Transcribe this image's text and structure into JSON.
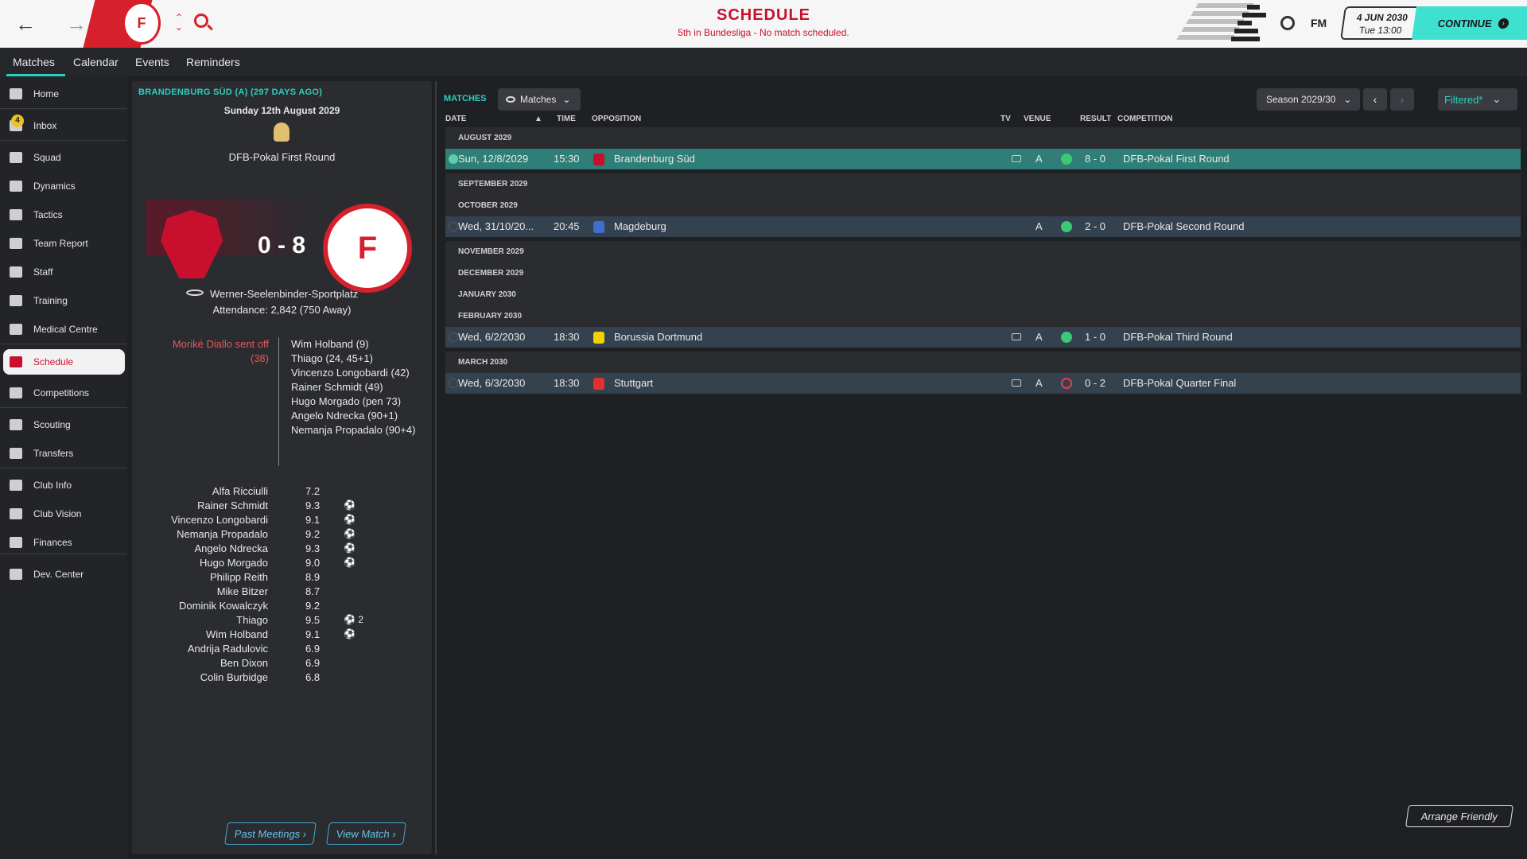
{
  "header": {
    "title": "SCHEDULE",
    "subtitle": "5th in Bundesliga - No match scheduled.",
    "date": "4 JUN 2030",
    "time": "Tue 13:00",
    "continue_label": "CONTINUE",
    "fm_label": "FM"
  },
  "tabs": [
    "Matches",
    "Calendar",
    "Events",
    "Reminders"
  ],
  "sidebar": {
    "inbox_badge": "4",
    "items": [
      {
        "label": "Home",
        "icon": "home-icon"
      },
      {
        "label": "Inbox",
        "icon": "inbox-icon"
      },
      {
        "label": "Squad",
        "icon": "squad-icon"
      },
      {
        "label": "Dynamics",
        "icon": "dynamics-icon"
      },
      {
        "label": "Tactics",
        "icon": "tactics-icon"
      },
      {
        "label": "Team Report",
        "icon": "report-icon"
      },
      {
        "label": "Staff",
        "icon": "staff-icon"
      },
      {
        "label": "Training",
        "icon": "training-icon"
      },
      {
        "label": "Medical Centre",
        "icon": "medical-icon"
      },
      {
        "label": "Schedule",
        "icon": "calendar-icon"
      },
      {
        "label": "Competitions",
        "icon": "trophy-icon"
      },
      {
        "label": "Scouting",
        "icon": "search-icon"
      },
      {
        "label": "Transfers",
        "icon": "transfer-icon"
      },
      {
        "label": "Club Info",
        "icon": "shield-icon"
      },
      {
        "label": "Club Vision",
        "icon": "vision-icon"
      },
      {
        "label": "Finances",
        "icon": "finance-icon"
      },
      {
        "label": "Dev. Center",
        "icon": "dev-center-icon"
      }
    ]
  },
  "match_panel": {
    "header": "BRANDENBURG SÜD (A) (297 DAYS AGO)",
    "date": "Sunday 12th August 2029",
    "competition": "DFB-Pokal First Round",
    "score": "0 - 8",
    "stadium": "Werner-Seelenbinder-Sportplatz",
    "attendance": "Attendance: 2,842 (750 Away)",
    "sent_off": "Moriké Diallo sent off (38)",
    "scorers": [
      "Wim Holband (9)",
      "Thiago (24, 45+1)",
      "Vincenzo Longobardi (42)",
      "Rainer Schmidt (49)",
      "Hugo Morgado (pen 73)",
      "Angelo Ndrecka (90+1)",
      "Nemanja Propadalo (90+4)"
    ],
    "ratings": [
      {
        "name": "Alfa Ricciulli",
        "rating": "7.2",
        "goals": ""
      },
      {
        "name": "Rainer Schmidt",
        "rating": "9.3",
        "goals": "⚽"
      },
      {
        "name": "Vincenzo Longobardi",
        "rating": "9.1",
        "goals": "⚽"
      },
      {
        "name": "Nemanja Propadalo",
        "rating": "9.2",
        "goals": "⚽"
      },
      {
        "name": "Angelo Ndrecka",
        "rating": "9.3",
        "goals": "⚽"
      },
      {
        "name": "Hugo Morgado",
        "rating": "9.0",
        "goals": "⚽"
      },
      {
        "name": "Philipp Reith",
        "rating": "8.9",
        "goals": ""
      },
      {
        "name": "Mike Bitzer",
        "rating": "8.7",
        "goals": ""
      },
      {
        "name": "Dominik Kowalczyk",
        "rating": "9.2",
        "goals": ""
      },
      {
        "name": "Thiago",
        "rating": "9.5",
        "goals": "⚽ 2"
      },
      {
        "name": "Wim Holband",
        "rating": "9.1",
        "goals": "⚽"
      },
      {
        "name": "Andrija Radulovic",
        "rating": "6.9",
        "goals": ""
      },
      {
        "name": "Ben Dixon",
        "rating": "6.9",
        "goals": ""
      },
      {
        "name": "Colin Burbidge",
        "rating": "6.8",
        "goals": ""
      }
    ],
    "past_meetings_label": "Past Meetings",
    "view_match_label": "View Match"
  },
  "matches": {
    "section_label": "MATCHES",
    "view_label": "Matches",
    "season_label": "Season 2029/30",
    "filter_label": "Filtered*",
    "columns": [
      "DATE",
      "TIME",
      "OPPOSITION",
      "TV",
      "VENUE",
      "RESULT",
      "COMPETITION"
    ],
    "rows": [
      {
        "type": "month",
        "label": "AUGUST 2029"
      },
      {
        "type": "match",
        "date": "Sun, 12/8/2029",
        "time": "15:30",
        "opposition": "Brandenburg Süd",
        "tv": true,
        "venue": "A",
        "outcome": "win",
        "result": "8 - 0",
        "competition": "DFB-Pokal First Round",
        "selected": true,
        "crest_color": "#c8102e"
      },
      {
        "type": "month",
        "label": "SEPTEMBER 2029"
      },
      {
        "type": "month",
        "label": "OCTOBER 2029"
      },
      {
        "type": "match",
        "date": "Wed, 31/10/20...",
        "time": "20:45",
        "opposition": "Magdeburg",
        "tv": false,
        "venue": "A",
        "outcome": "win",
        "result": "2 - 0",
        "competition": "DFB-Pokal Second Round",
        "selected": false,
        "crest_color": "#3b6fd0"
      },
      {
        "type": "month",
        "label": "NOVEMBER 2029"
      },
      {
        "type": "month",
        "label": "DECEMBER 2029"
      },
      {
        "type": "month",
        "label": "JANUARY 2030"
      },
      {
        "type": "month",
        "label": "FEBRUARY 2030"
      },
      {
        "type": "match",
        "date": "Wed, 6/2/2030",
        "time": "18:30",
        "opposition": "Borussia Dortmund",
        "tv": true,
        "venue": "A",
        "outcome": "win",
        "result": "1 - 0",
        "competition": "DFB-Pokal Third Round",
        "selected": false,
        "crest_color": "#f5d000"
      },
      {
        "type": "month",
        "label": "MARCH 2030"
      },
      {
        "type": "match",
        "date": "Wed, 6/3/2030",
        "time": "18:30",
        "opposition": "Stuttgart",
        "tv": true,
        "venue": "A",
        "outcome": "loss",
        "result": "0 - 2",
        "competition": "DFB-Pokal Quarter Final",
        "selected": false,
        "crest_color": "#e03030"
      }
    ],
    "arrange_friendly_label": "Arrange Friendly"
  }
}
